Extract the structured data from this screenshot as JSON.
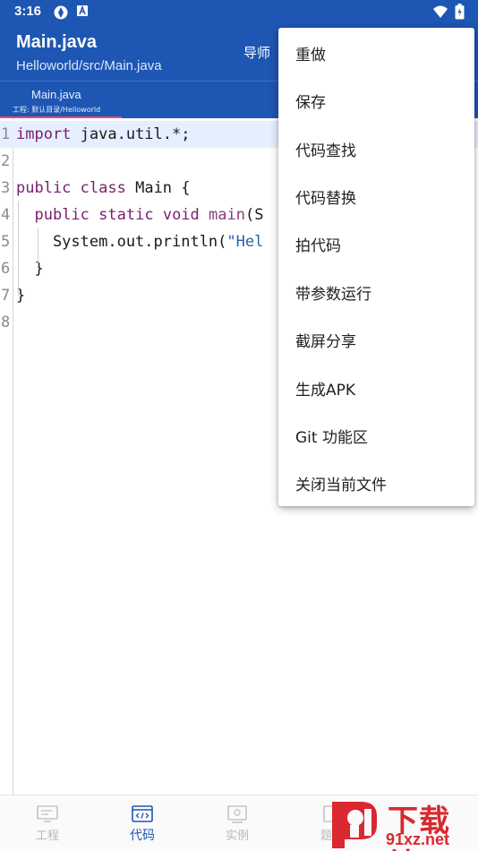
{
  "status_bar": {
    "time": "3:16",
    "icons": [
      "sync-icon",
      "a-badge-icon",
      "wifi-icon",
      "battery-icon"
    ]
  },
  "app_bar": {
    "title": "Main.java",
    "subtitle": "Helloworld/src/Main.java",
    "nav_label": "导师"
  },
  "tabs": [
    {
      "title": "Main.java",
      "subtitle": "工程: 默认目录/Helloworld"
    }
  ],
  "editor": {
    "lines": [
      {
        "number": "1",
        "tokens": [
          {
            "t": "kw",
            "v": "import"
          },
          {
            "t": "",
            "v": " java.util.*;"
          }
        ]
      },
      {
        "number": "2",
        "tokens": []
      },
      {
        "number": "3",
        "tokens": [
          {
            "t": "kw",
            "v": "public"
          },
          {
            "t": "",
            "v": " "
          },
          {
            "t": "kw",
            "v": "class"
          },
          {
            "t": "",
            "v": " Main {"
          }
        ]
      },
      {
        "number": "4",
        "tokens": [
          {
            "t": "",
            "v": "  "
          },
          {
            "t": "kw",
            "v": "public"
          },
          {
            "t": "",
            "v": " "
          },
          {
            "t": "kw",
            "v": "static"
          },
          {
            "t": "",
            "v": " "
          },
          {
            "t": "kw",
            "v": "void"
          },
          {
            "t": "",
            "v": " "
          },
          {
            "t": "fn",
            "v": "main"
          },
          {
            "t": "",
            "v": "(S"
          }
        ]
      },
      {
        "number": "5",
        "tokens": [
          {
            "t": "",
            "v": "    System.out.println("
          },
          {
            "t": "str",
            "v": "\"Hel"
          }
        ]
      },
      {
        "number": "6",
        "tokens": [
          {
            "t": "",
            "v": "  }"
          }
        ]
      },
      {
        "number": "7",
        "tokens": [
          {
            "t": "",
            "v": "}"
          }
        ]
      },
      {
        "number": "8",
        "tokens": []
      }
    ]
  },
  "menu": {
    "items": [
      {
        "label": "重做"
      },
      {
        "label": "保存"
      },
      {
        "label": "代码查找"
      },
      {
        "label": "代码替换"
      },
      {
        "label": "拍代码"
      },
      {
        "label": "带参数运行"
      },
      {
        "label": "截屏分享"
      },
      {
        "label": "生成APK"
      },
      {
        "label": "Git 功能区"
      },
      {
        "label": "关闭当前文件"
      }
    ]
  },
  "bottom_nav": {
    "items": [
      {
        "label": "工程",
        "icon": "project-icon",
        "active": false
      },
      {
        "label": "代码",
        "icon": "code-icon",
        "active": true
      },
      {
        "label": "实例",
        "icon": "examples-icon",
        "active": false
      },
      {
        "label": "题库",
        "icon": "question-bank-icon",
        "active": false
      }
    ]
  },
  "watermark": {
    "text": "下载站",
    "url": "91xz.net"
  },
  "colors": {
    "primary": "#1e56b3",
    "tab_indicator": "#ef4a6f",
    "keyword": "#7a1e6e",
    "string": "#2b5fa8",
    "annotation_arrow": "#d9282f"
  }
}
